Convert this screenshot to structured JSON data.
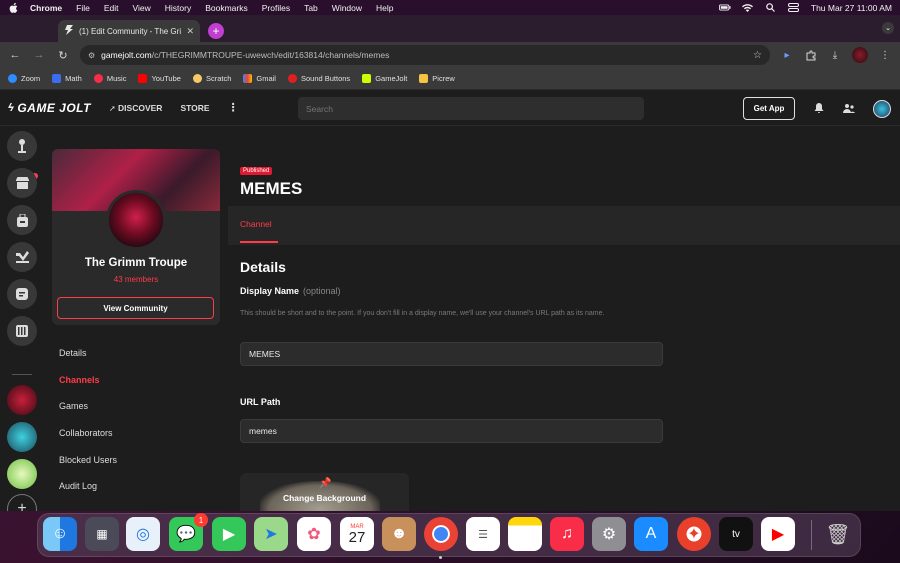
{
  "menubar": {
    "app": "Chrome",
    "items": [
      "File",
      "Edit",
      "View",
      "History",
      "Bookmarks",
      "Profiles",
      "Tab",
      "Window",
      "Help"
    ],
    "clock": "Thu Mar 27  11:00 AM"
  },
  "browser": {
    "tab_title": "(1) Edit Community - The Gri",
    "url_host": "gamejolt.com",
    "url_path": "/c/THEGRIMMTROUPE-uwewch/edit/163814/channels/memes",
    "bookmarks": [
      {
        "label": "Zoom",
        "color": "#2d8cff"
      },
      {
        "label": "Math",
        "color": "#3c6cf0"
      },
      {
        "label": "Music",
        "color": "#fa2d48"
      },
      {
        "label": "YouTube",
        "color": "#ff0000"
      },
      {
        "label": "Scratch",
        "color": "#f6c86a"
      },
      {
        "label": "Gmail",
        "color": "#ea4335"
      },
      {
        "label": "Sound Buttons",
        "color": "#e02020"
      },
      {
        "label": "GameJolt",
        "color": "#ccff00"
      },
      {
        "label": "Picrew",
        "color": "#f5c542"
      }
    ]
  },
  "gamejolt": {
    "logo": "GAME JOLT",
    "nav_discover": "DISCOVER",
    "nav_store": "STORE",
    "search_placeholder": "Search",
    "get_app": "Get App"
  },
  "community": {
    "name": "The Grimm Troupe",
    "members": "43 members",
    "view_button": "View Community",
    "nav": [
      {
        "label": "Details",
        "active": false
      },
      {
        "label": "Channels",
        "active": true
      },
      {
        "label": "Games",
        "active": false
      },
      {
        "label": "Collaborators",
        "active": false
      },
      {
        "label": "Blocked Users",
        "active": false
      },
      {
        "label": "Audit Log",
        "active": false
      }
    ]
  },
  "channel": {
    "badge": "Published",
    "title": "MEMES",
    "tab": "Channel",
    "section_title": "Details",
    "display_name_label": "Display Name",
    "display_name_optional": "(optional)",
    "display_name_help": "This should be short and to the point. If you don't fill in a display name, we'll use your channel's URL path as its name.",
    "display_name_value": "MEMES",
    "url_path_label": "URL Path",
    "url_path_value": "memes",
    "change_background": "Change Background"
  },
  "dock": {
    "messages_badge": "1",
    "calendar_month": "MAR",
    "calendar_day": "27",
    "tv_label": "tv"
  },
  "colors": {
    "accent": "#ff3c4a",
    "page_bg": "#1d1d1d"
  }
}
